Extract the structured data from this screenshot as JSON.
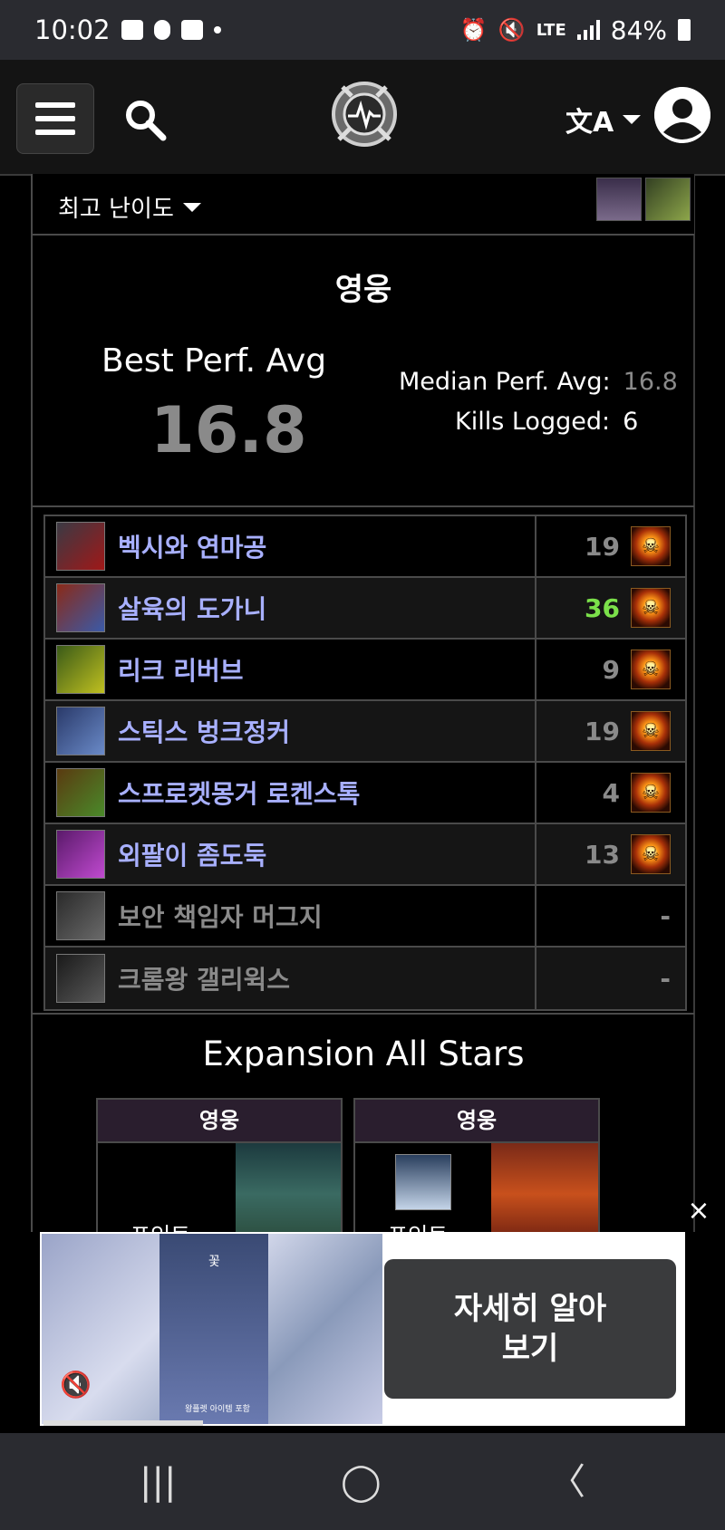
{
  "status_bar": {
    "time": "10:02",
    "network": "LTE",
    "battery": "84%"
  },
  "top_nav": {
    "logo_icon": "warcraftlogs-logo-icon",
    "lang_glyph": "文A"
  },
  "content": {
    "difficulty_selector": "최고 난이도",
    "summary": {
      "difficulty": "영웅",
      "best_perf_label": "Best Perf. Avg",
      "best_perf_value": "16.8",
      "median_label": "Median Perf. Avg:",
      "median_value": "16.8",
      "kills_label": "Kills Logged:",
      "kills_value": "6"
    },
    "bosses": [
      {
        "name": "벡시와 연마공",
        "score": "19",
        "highlight": false,
        "killed": true
      },
      {
        "name": "살육의 도가니",
        "score": "36",
        "highlight": true,
        "killed": true
      },
      {
        "name": "리크 리버브",
        "score": "9",
        "highlight": false,
        "killed": true
      },
      {
        "name": "스틱스 벙크정커",
        "score": "19",
        "highlight": false,
        "killed": true
      },
      {
        "name": "스프로켓몽거 로켄스톡",
        "score": "4",
        "highlight": false,
        "killed": true
      },
      {
        "name": "외팔이 좀도둑",
        "score": "13",
        "highlight": false,
        "killed": true
      },
      {
        "name": "보안 책임자 머그지",
        "score": "-",
        "highlight": false,
        "killed": false
      },
      {
        "name": "크롬왕 갤리윅스",
        "score": "-",
        "highlight": false,
        "killed": false
      }
    ],
    "all_stars": {
      "title": "Expansion All Stars",
      "cards": [
        {
          "difficulty": "영웅",
          "label": "포인트"
        },
        {
          "difficulty": "영웅",
          "label": "포인트"
        }
      ]
    }
  },
  "ad": {
    "cta": "자세히 알아 보기",
    "cta_line1": "자세히 알아",
    "cta_line2": "보기",
    "caption_top": "꽃",
    "caption_bottom": "왕플렛 아이템 포함"
  },
  "nav_bar": {
    "recents": "|||",
    "home": "◯",
    "back": "〈"
  }
}
